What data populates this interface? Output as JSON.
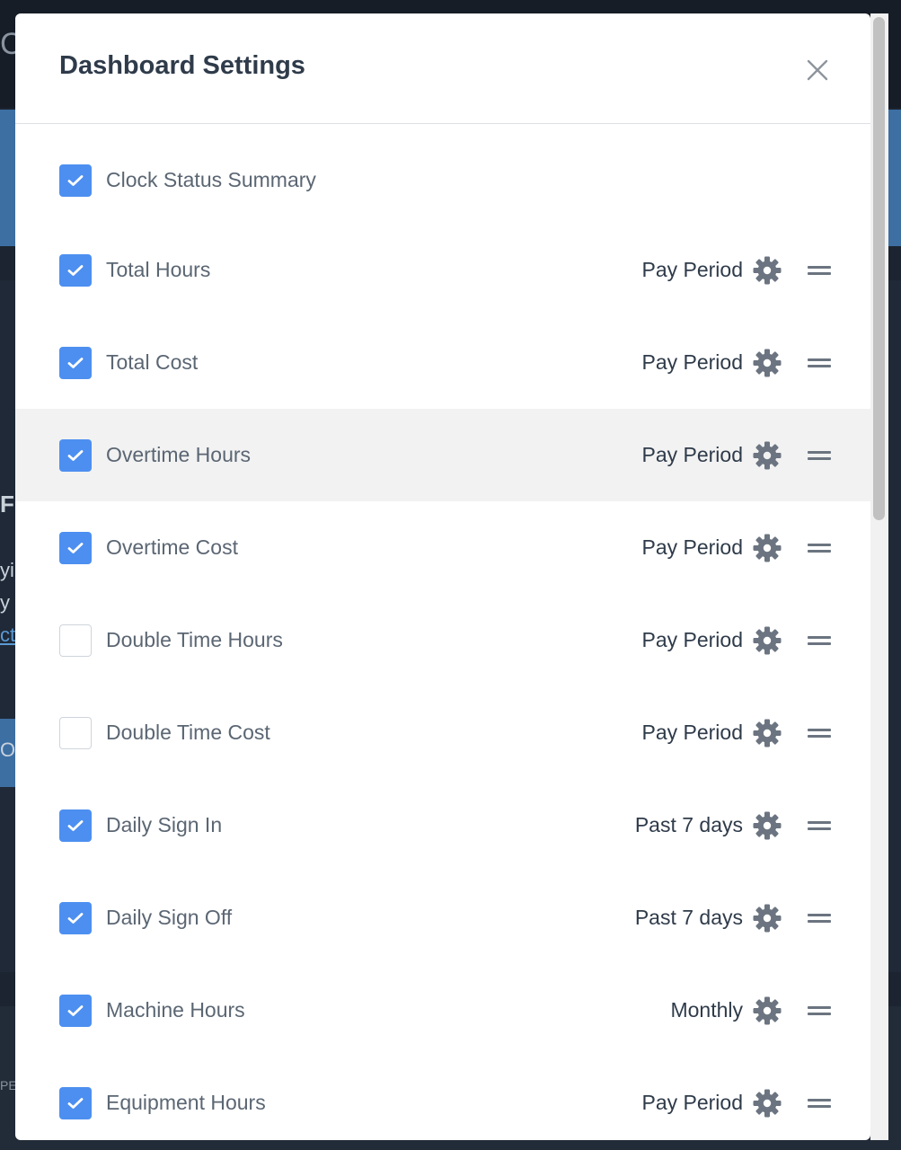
{
  "background": {
    "fragments": [
      "C",
      "Fr",
      "yi",
      "y c",
      "ct",
      "Ov",
      "PE"
    ]
  },
  "modal": {
    "title": "Dashboard Settings",
    "close_label": "×"
  },
  "settings": [
    {
      "label": "Clock Status Summary",
      "checked": true,
      "period": ""
    },
    {
      "label": "Total Hours",
      "checked": true,
      "period": "Pay Period"
    },
    {
      "label": "Total Cost",
      "checked": true,
      "period": "Pay Period"
    },
    {
      "label": "Overtime Hours",
      "checked": true,
      "period": "Pay Period",
      "highlighted": true
    },
    {
      "label": "Overtime Cost",
      "checked": true,
      "period": "Pay Period"
    },
    {
      "label": "Double Time Hours",
      "checked": false,
      "period": "Pay Period"
    },
    {
      "label": "Double Time Cost",
      "checked": false,
      "period": "Pay Period"
    },
    {
      "label": "Daily Sign In",
      "checked": true,
      "period": "Past 7 days"
    },
    {
      "label": "Daily Sign Off",
      "checked": true,
      "period": "Past 7 days"
    },
    {
      "label": "Machine Hours",
      "checked": true,
      "period": "Monthly"
    },
    {
      "label": "Equipment Hours",
      "checked": true,
      "period": "Pay Period"
    }
  ],
  "colors": {
    "checkbox_checked": "#4d8ff0",
    "title_text": "#2f3b4a",
    "label_text": "#5b6673",
    "icon_gray": "#6b7480",
    "highlight_row": "#f2f2f2"
  },
  "icons": {
    "close": "close-icon",
    "settings": "gear-icon",
    "reorder": "drag-handle-icon",
    "check": "checkmark-icon"
  }
}
